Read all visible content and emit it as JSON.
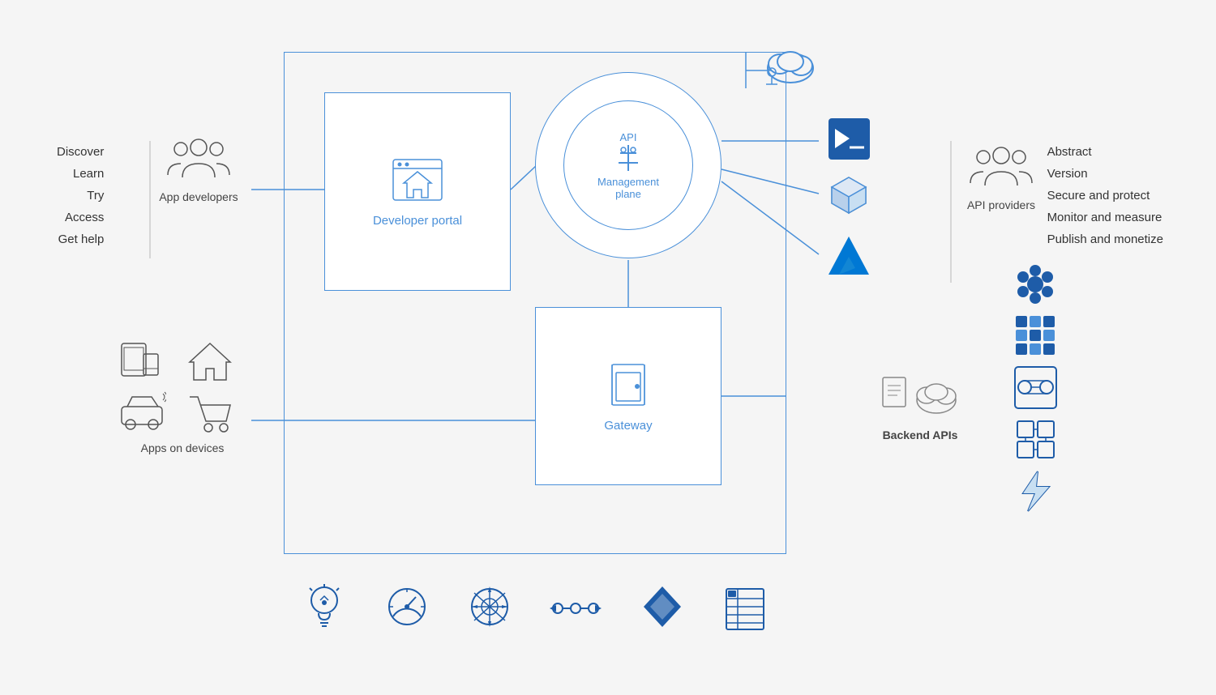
{
  "left_actions": {
    "items": [
      "Discover",
      "Learn",
      "Try",
      "Access",
      "Get help"
    ]
  },
  "app_developers": {
    "label": "App developers"
  },
  "apps_devices": {
    "label": "Apps on devices"
  },
  "developer_portal": {
    "label": "Developer portal"
  },
  "api_circle": {
    "top_label": "API",
    "main_label": "Management\nplane"
  },
  "gateway": {
    "label": "Gateway"
  },
  "api_providers": {
    "label": "API providers"
  },
  "right_actions": {
    "items": [
      "Abstract",
      "Version",
      "Secure and protect",
      "Monitor and measure",
      "Publish and monetize"
    ]
  },
  "backend_apis": {
    "label": "Backend APIs"
  },
  "colors": {
    "blue": "#1a6eb5",
    "light_blue": "#4a90d9",
    "dark_blue": "#1e4d8c",
    "border": "#6aadde"
  }
}
